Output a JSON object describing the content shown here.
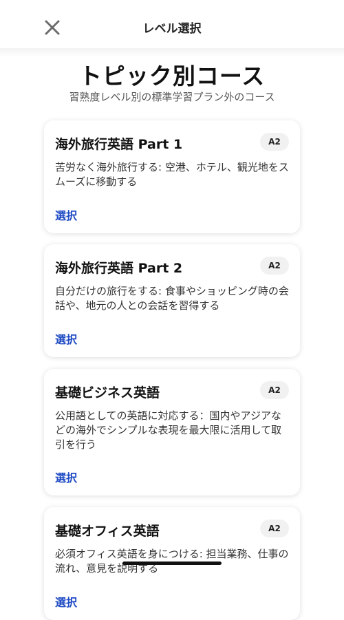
{
  "header": {
    "title": "レベル選択"
  },
  "page": {
    "title": "トピック別コース",
    "subtitle": "習熟度レベル別の標準学習プラン外のコース"
  },
  "courses": [
    {
      "title": "海外旅行英語 Part 1",
      "level": "A2",
      "description": "苦労なく海外旅行する: 空港、ホテル、観光地をスムーズに移動する",
      "action": "選択"
    },
    {
      "title": "海外旅行英語 Part 2",
      "level": "A2",
      "description": "自分だけの旅行をする: 食事やショッピング時の会話や、地元の人との会話を習得する",
      "action": "選択"
    },
    {
      "title": "基礎ビジネス英語",
      "level": "A2",
      "description": "公用語としての英語に対応する：国内やアジアなどの海外でシンプルな表現を最大限に活用して取引を行う",
      "action": "選択"
    },
    {
      "title": "基礎オフィス英語",
      "level": "A2",
      "description": "必須オフィス英語を身につける: 担当業務、仕事の流れ、意見を説明する",
      "action": "選択"
    }
  ],
  "icons": {
    "close": "close-icon"
  }
}
